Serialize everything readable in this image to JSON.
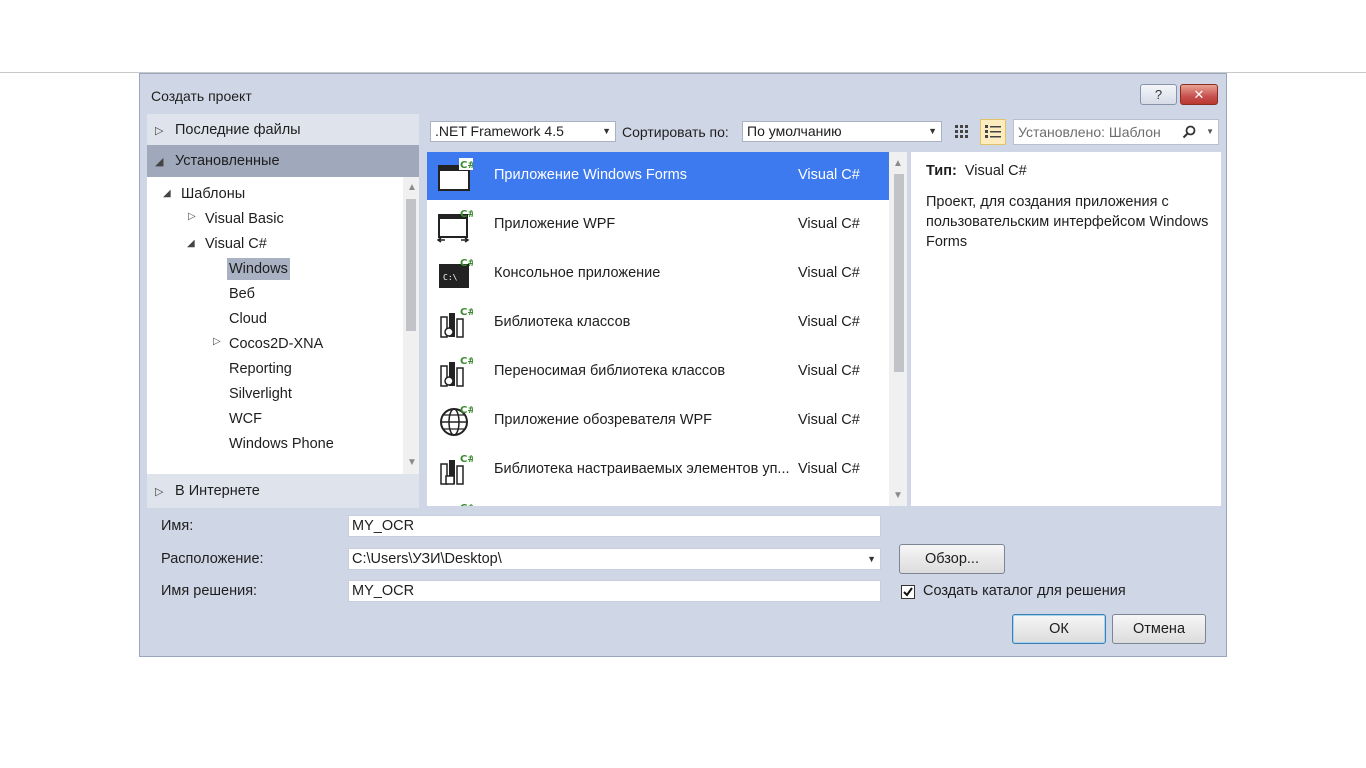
{
  "dialog": {
    "title": "Создать проект",
    "help_label": "?",
    "close_label": "✕"
  },
  "nav": {
    "recent": "Последние файлы",
    "installed": "Установленные",
    "online": "В Интернете",
    "tree": {
      "templates": "Шаблоны",
      "visual_basic": "Visual Basic",
      "visual_csharp": "Visual C#",
      "children": [
        "Windows",
        "Веб",
        "Cloud",
        "Cocos2D-XNA",
        "Reporting",
        "Silverlight",
        "WCF",
        "Windows Phone"
      ],
      "selected": "Windows"
    }
  },
  "toolbar": {
    "framework": ".NET Framework 4.5",
    "sort_label": "Сортировать по:",
    "sort_value": "По умолчанию",
    "search_placeholder": "Установлено: Шаблон"
  },
  "templates": [
    {
      "name": "Приложение Windows Forms",
      "lang": "Visual C#",
      "icon": "winforms-icon",
      "selected": true
    },
    {
      "name": "Приложение WPF",
      "lang": "Visual C#",
      "icon": "wpf-icon",
      "selected": false
    },
    {
      "name": "Консольное приложение",
      "lang": "Visual C#",
      "icon": "console-icon",
      "selected": false
    },
    {
      "name": "Библиотека классов",
      "lang": "Visual C#",
      "icon": "class-library-icon",
      "selected": false
    },
    {
      "name": "Переносимая библиотека классов",
      "lang": "Visual C#",
      "icon": "portable-library-icon",
      "selected": false
    },
    {
      "name": "Приложение обозревателя WPF",
      "lang": "Visual C#",
      "icon": "wpf-browser-icon",
      "selected": false
    },
    {
      "name": "Библиотека настраиваемых элементов уп...",
      "lang": "Visual C#",
      "icon": "control-library-icon",
      "selected": false
    }
  ],
  "details": {
    "type_label": "Тип:",
    "type_value": "Visual C#",
    "description": "Проект, для создания приложения с пользовательским интерфейсом Windows Forms"
  },
  "form": {
    "name_label": "Имя:",
    "name_value": "MY_OCR",
    "location_label": "Расположение:",
    "location_value": "C:\\Users\\УЗИ\\Desktop\\",
    "solution_label": "Имя решения:",
    "solution_value": "MY_OCR",
    "browse_label": "Обзор...",
    "create_dir_label": "Создать каталог для решения",
    "create_dir_checked": true,
    "ok_label": "ОК",
    "cancel_label": "Отмена"
  }
}
